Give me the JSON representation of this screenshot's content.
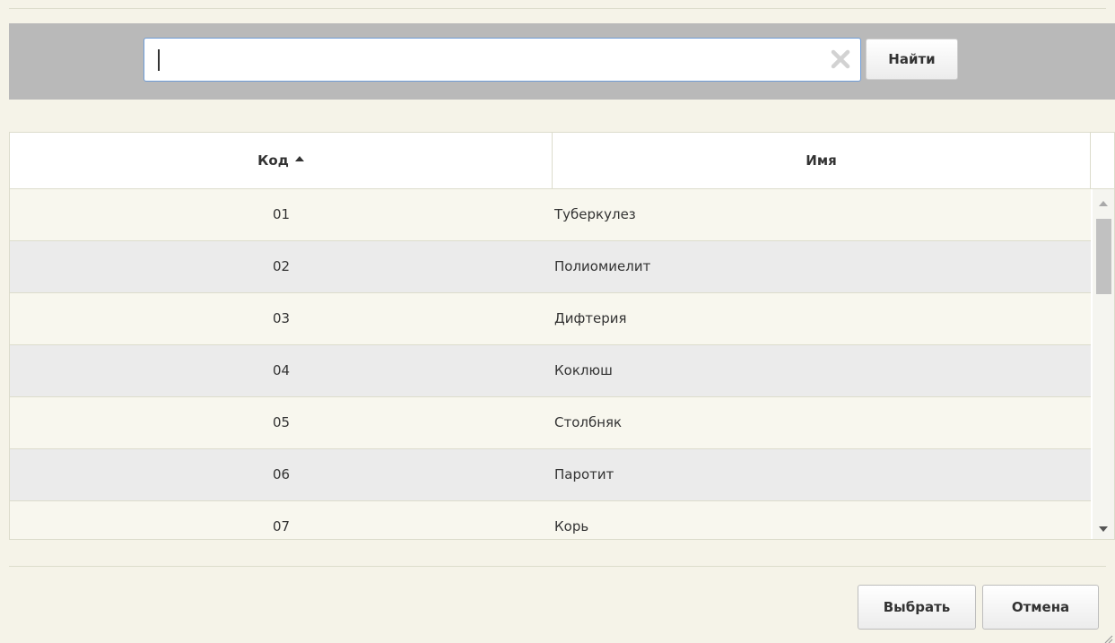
{
  "search": {
    "value": "",
    "find_label": "Найти"
  },
  "grid": {
    "columns": [
      {
        "label": "Код",
        "sort": "ascending"
      },
      {
        "label": "Имя"
      }
    ],
    "rows": [
      {
        "code": "01",
        "name": "Туберкулез"
      },
      {
        "code": "02",
        "name": "Полиомиелит"
      },
      {
        "code": "03",
        "name": "Дифтерия"
      },
      {
        "code": "04",
        "name": "Коклюш"
      },
      {
        "code": "05",
        "name": "Столбняк"
      },
      {
        "code": "06",
        "name": "Паротит"
      },
      {
        "code": "07",
        "name": "Корь"
      }
    ]
  },
  "footer": {
    "select_label": "Выбрать",
    "cancel_label": "Отмена"
  },
  "colors": {
    "dialog_background": "#f5f3e8",
    "search_band": "#b9b9b9",
    "input_border": "#6d9bd6",
    "row_odd": "#f8f7ee",
    "row_even": "#ebebeb"
  },
  "icons": {
    "clear": "clear-x-icon",
    "sort": "sort-ascending-icon",
    "scroll_up": "scroll-up-icon",
    "scroll_down": "scroll-down-icon",
    "resize": "resize-grip-icon"
  }
}
